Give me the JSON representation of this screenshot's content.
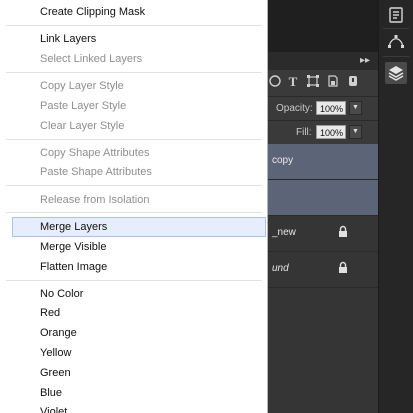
{
  "menu": {
    "items": [
      {
        "label": "Create Clipping Mask"
      },
      {
        "label": "Link Layers"
      },
      {
        "label": "Select Linked Layers"
      },
      {
        "label": "Copy Layer Style"
      },
      {
        "label": "Paste Layer Style"
      },
      {
        "label": "Clear Layer Style"
      },
      {
        "label": "Copy Shape Attributes"
      },
      {
        "label": "Paste Shape Attributes"
      },
      {
        "label": "Release from Isolation"
      },
      {
        "label": "Merge Layers"
      },
      {
        "label": "Merge Visible"
      },
      {
        "label": "Flatten Image"
      },
      {
        "label": "No Color"
      },
      {
        "label": "Red"
      },
      {
        "label": "Orange"
      },
      {
        "label": "Yellow"
      },
      {
        "label": "Green"
      },
      {
        "label": "Blue"
      },
      {
        "label": "Violet"
      }
    ],
    "highlighted": "Merge Layers",
    "highlight_color": "#e6eefb",
    "highlight_border": "#a8c4ea"
  },
  "layers_panel": {
    "collapse_icon": "double-chevron-right-icon",
    "filter_icons": [
      "type-filter-icon",
      "shape-filter-icon",
      "smart-object-filter-icon",
      "filter-toggle-icon"
    ],
    "opacity_label": "Opacity:",
    "opacity_value": "100%",
    "fill_label": "Fill:",
    "fill_value": "100%",
    "layers": [
      {
        "name": "copy",
        "selected": true,
        "locked": false,
        "italic": false
      },
      {
        "name": "",
        "selected": true,
        "locked": false,
        "italic": false
      },
      {
        "name": "_new",
        "selected": false,
        "locked": true,
        "italic": false
      },
      {
        "name": "und",
        "selected": false,
        "locked": true,
        "italic": true
      }
    ],
    "selected_color": "#5c6578"
  },
  "toolstrip": {
    "tools": [
      "info-panel-icon",
      "paths-panel-icon",
      "layers-panel-icon"
    ],
    "active": "layers-panel-icon"
  }
}
